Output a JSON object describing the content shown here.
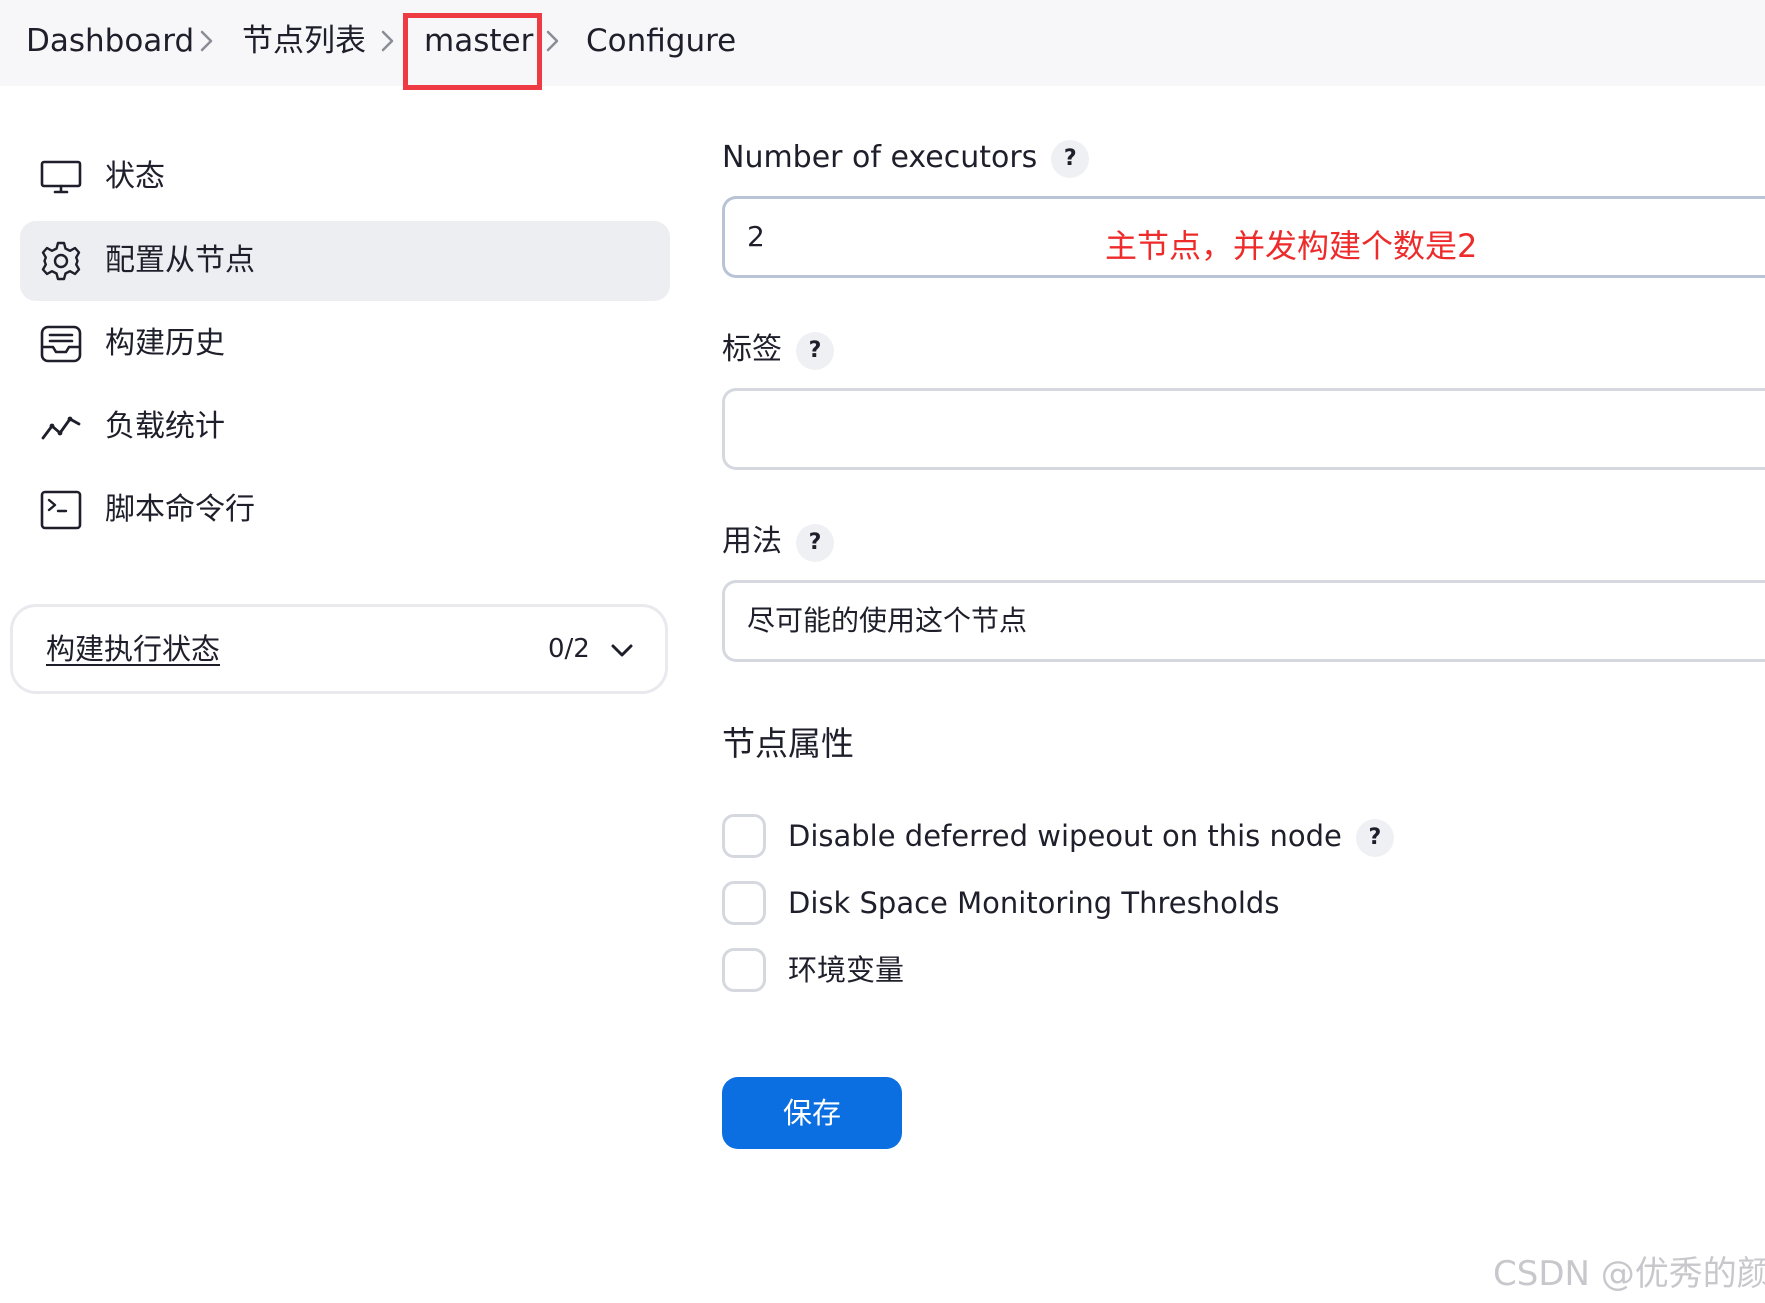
{
  "breadcrumb": {
    "items": [
      "Dashboard",
      "节点列表",
      "master",
      "Configure"
    ]
  },
  "sidebar": {
    "items": [
      {
        "label": "状态",
        "icon": "monitor-icon"
      },
      {
        "label": "配置从节点",
        "icon": "gear-icon",
        "active": true
      },
      {
        "label": "构建历史",
        "icon": "inbox-icon"
      },
      {
        "label": "负载统计",
        "icon": "trend-line-icon"
      },
      {
        "label": "脚本命令行",
        "icon": "terminal-icon"
      }
    ],
    "executor_status": {
      "title": "构建执行状态",
      "count": "0/2"
    }
  },
  "form": {
    "executors": {
      "label": "Number of executors",
      "help": "?",
      "value": "2"
    },
    "labels": {
      "label": "标签",
      "help": "?",
      "value": ""
    },
    "usage": {
      "label": "用法",
      "help": "?",
      "value": "尽可能的使用这个节点"
    },
    "node_properties_title": "节点属性",
    "checkboxes": [
      {
        "label": "Disable deferred wipeout on this node",
        "help": "?",
        "checked": false
      },
      {
        "label": "Disk Space Monitoring Thresholds",
        "checked": false
      },
      {
        "label": "环境变量",
        "checked": false
      }
    ],
    "save_label": "保存"
  },
  "annotation": "主节点，并发构建个数是2",
  "watermark": "CSDN @优秀的颜",
  "colors": {
    "accent": "#0b6fe2",
    "highlight_red": "#ee3a43",
    "annotation_red": "#ee2b2b"
  }
}
